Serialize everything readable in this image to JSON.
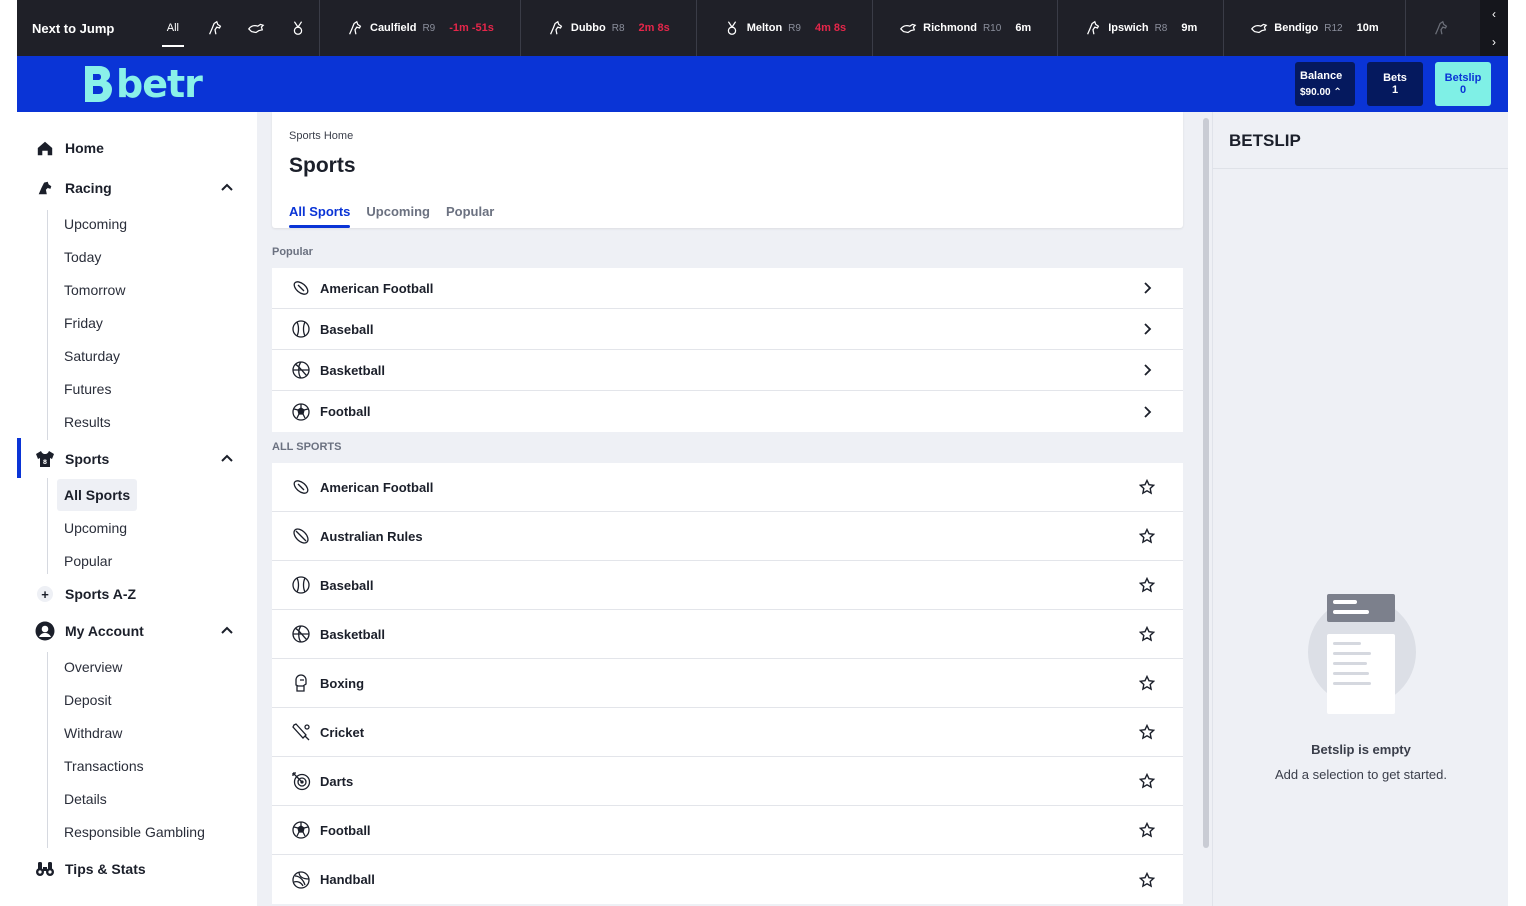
{
  "next_to_jump": {
    "title": "Next to Jump",
    "filters": [
      {
        "label": "All",
        "icon": ""
      },
      {
        "label": "",
        "icon": "horse-racing-icon"
      },
      {
        "label": "",
        "icon": "greyhound-icon"
      },
      {
        "label": "",
        "icon": "harness-racing-icon"
      }
    ],
    "races": [
      {
        "venue": "Caulfield",
        "race": "R9",
        "time": "-1m -51s",
        "urgent": true,
        "icon": "horse-racing-icon"
      },
      {
        "venue": "Dubbo",
        "race": "R8",
        "time": "2m 8s",
        "urgent": true,
        "icon": "horse-racing-icon"
      },
      {
        "venue": "Melton",
        "race": "R9",
        "time": "4m 8s",
        "urgent": true,
        "icon": "harness-racing-icon"
      },
      {
        "venue": "Richmond",
        "race": "R10",
        "time": "6m",
        "urgent": false,
        "icon": "greyhound-icon"
      },
      {
        "venue": "Ipswich",
        "race": "R8",
        "time": "9m",
        "urgent": false,
        "icon": "horse-racing-icon"
      },
      {
        "venue": "Bendigo",
        "race": "R12",
        "time": "10m",
        "urgent": false,
        "icon": "greyhound-icon"
      }
    ]
  },
  "header": {
    "logo_text": "betr",
    "balance_label": "Balance",
    "balance_value": "$90.00",
    "bets_label": "Bets",
    "bets_count": "1",
    "betslip_label": "Betslip",
    "betslip_count": "0"
  },
  "sidebar": {
    "home": "Home",
    "racing": {
      "label": "Racing",
      "items": [
        "Upcoming",
        "Today",
        "Tomorrow",
        "Friday",
        "Saturday",
        "Futures",
        "Results"
      ]
    },
    "sports": {
      "label": "Sports",
      "items": [
        "All Sports",
        "Upcoming",
        "Popular"
      ]
    },
    "sports_az": "Sports A-Z",
    "account": {
      "label": "My Account",
      "items": [
        "Overview",
        "Deposit",
        "Withdraw",
        "Transactions",
        "Details",
        "Responsible Gambling"
      ]
    },
    "tips": "Tips & Stats"
  },
  "main": {
    "breadcrumb": "Sports Home",
    "title": "Sports",
    "tabs": [
      "All Sports",
      "Upcoming",
      "Popular"
    ],
    "popular_label": "Popular",
    "popular": [
      {
        "name": "American Football",
        "icon": "american-football-icon"
      },
      {
        "name": "Baseball",
        "icon": "baseball-icon"
      },
      {
        "name": "Basketball",
        "icon": "basketball-icon"
      },
      {
        "name": "Football",
        "icon": "soccer-ball-icon"
      }
    ],
    "all_label": "ALL SPORTS",
    "all": [
      {
        "name": "American Football",
        "icon": "american-football-icon"
      },
      {
        "name": "Australian Rules",
        "icon": "aussie-rules-icon"
      },
      {
        "name": "Baseball",
        "icon": "baseball-icon"
      },
      {
        "name": "Basketball",
        "icon": "basketball-icon"
      },
      {
        "name": "Boxing",
        "icon": "boxing-glove-icon"
      },
      {
        "name": "Cricket",
        "icon": "cricket-icon"
      },
      {
        "name": "Darts",
        "icon": "darts-icon"
      },
      {
        "name": "Football",
        "icon": "soccer-ball-icon"
      },
      {
        "name": "Handball",
        "icon": "handball-icon"
      }
    ]
  },
  "betslip": {
    "title": "BETSLIP",
    "empty_title": "Betslip is empty",
    "empty_sub": "Add a selection to get started."
  },
  "colors": {
    "brand_blue": "#0a34d6",
    "accent_teal": "#7ff0e6",
    "dark_bar": "#1f2028",
    "urgent_red": "#e5264a"
  }
}
